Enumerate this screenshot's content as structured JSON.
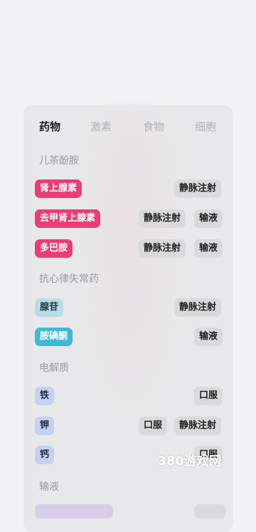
{
  "tabs": [
    "药物",
    "激素",
    "食物",
    "细胞"
  ],
  "sections": [
    "儿茶酚胺",
    "抗心律失常药",
    "电解质",
    "输液"
  ],
  "rows": [
    {
      "name": "肾上腺素",
      "routes": [
        "静脉注射"
      ]
    },
    {
      "name": "去甲肾上腺素",
      "routes": [
        "静脉注射",
        "输液"
      ]
    },
    {
      "name": "多巴胺",
      "routes": [
        "静脉注射",
        "输液"
      ]
    },
    {
      "name": "腺苷",
      "routes": [
        "静脉注射"
      ]
    },
    {
      "name": "胺碘酮",
      "routes": [
        "输液"
      ]
    },
    {
      "name": "铁",
      "routes": [
        "口服"
      ]
    },
    {
      "name": "钾",
      "routes": [
        "口服",
        "静脉注射"
      ]
    },
    {
      "name": "钙",
      "routes": [
        "口服"
      ]
    },
    {
      "name": "",
      "routes": [
        ""
      ]
    }
  ],
  "watermark": "380游戏网",
  "colors": {
    "catecholamine_chip": "#ea3d74",
    "antiarrhythmic_chip_1": "#b9dce4",
    "antiarrhythmic_chip_2": "#3fb9d7",
    "electrolyte_chip": "#c5d2ee",
    "route_chip": "#dadadc",
    "panel": "#e6e6e8"
  }
}
